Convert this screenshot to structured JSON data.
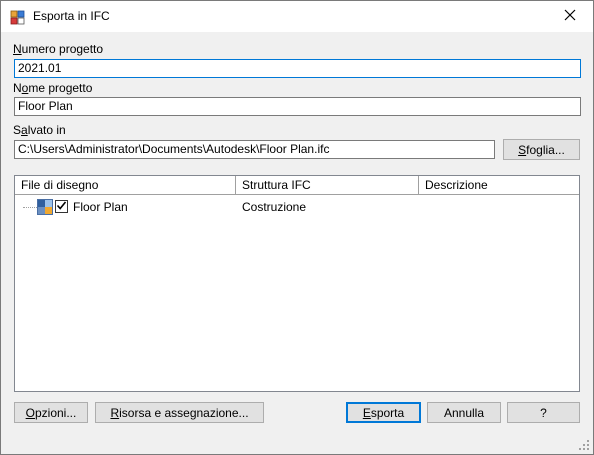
{
  "window": {
    "title": "Esporta in IFC",
    "close_glyph": "✕"
  },
  "form": {
    "project_number": {
      "label": "Numero progetto",
      "mnemonic": "N",
      "rest": "umero progetto",
      "value": "2021.01"
    },
    "project_name": {
      "label": "Nome progetto",
      "mnemonic": "o",
      "pre": "N",
      "rest": "me progetto",
      "value": "Floor Plan"
    },
    "saved_in": {
      "label": "Salvato in",
      "pre": "S",
      "mnemonic": "a",
      "rest": "lvato in",
      "value": "C:\\Users\\Administrator\\Documents\\Autodesk\\Floor Plan.ifc"
    },
    "browse": {
      "label": "Sfoglia...",
      "mnemonic": "S",
      "rest": "foglia..."
    }
  },
  "table": {
    "columns": [
      "File di disegno",
      "Struttura IFC",
      "Descrizione"
    ],
    "rows": [
      {
        "name": "Floor Plan",
        "ifc_structure": "Costruzione",
        "description": "",
        "checked": true,
        "icon": "drawing-file-icon"
      }
    ]
  },
  "buttons": {
    "options": {
      "label": "Opzioni...",
      "mnemonic": "O",
      "rest": "pzioni..."
    },
    "resource": {
      "label": "Risorsa e assegnazione...",
      "mnemonic": "R",
      "rest": "isorsa e assegnazione..."
    },
    "export": {
      "label": "Esporta",
      "mnemonic": "E",
      "rest": "sporta"
    },
    "cancel": {
      "label": "Annulla"
    },
    "help": {
      "label": "?"
    }
  },
  "colors": {
    "focus_border": "#0078d7",
    "dialog_bg": "#f0f0f0"
  }
}
